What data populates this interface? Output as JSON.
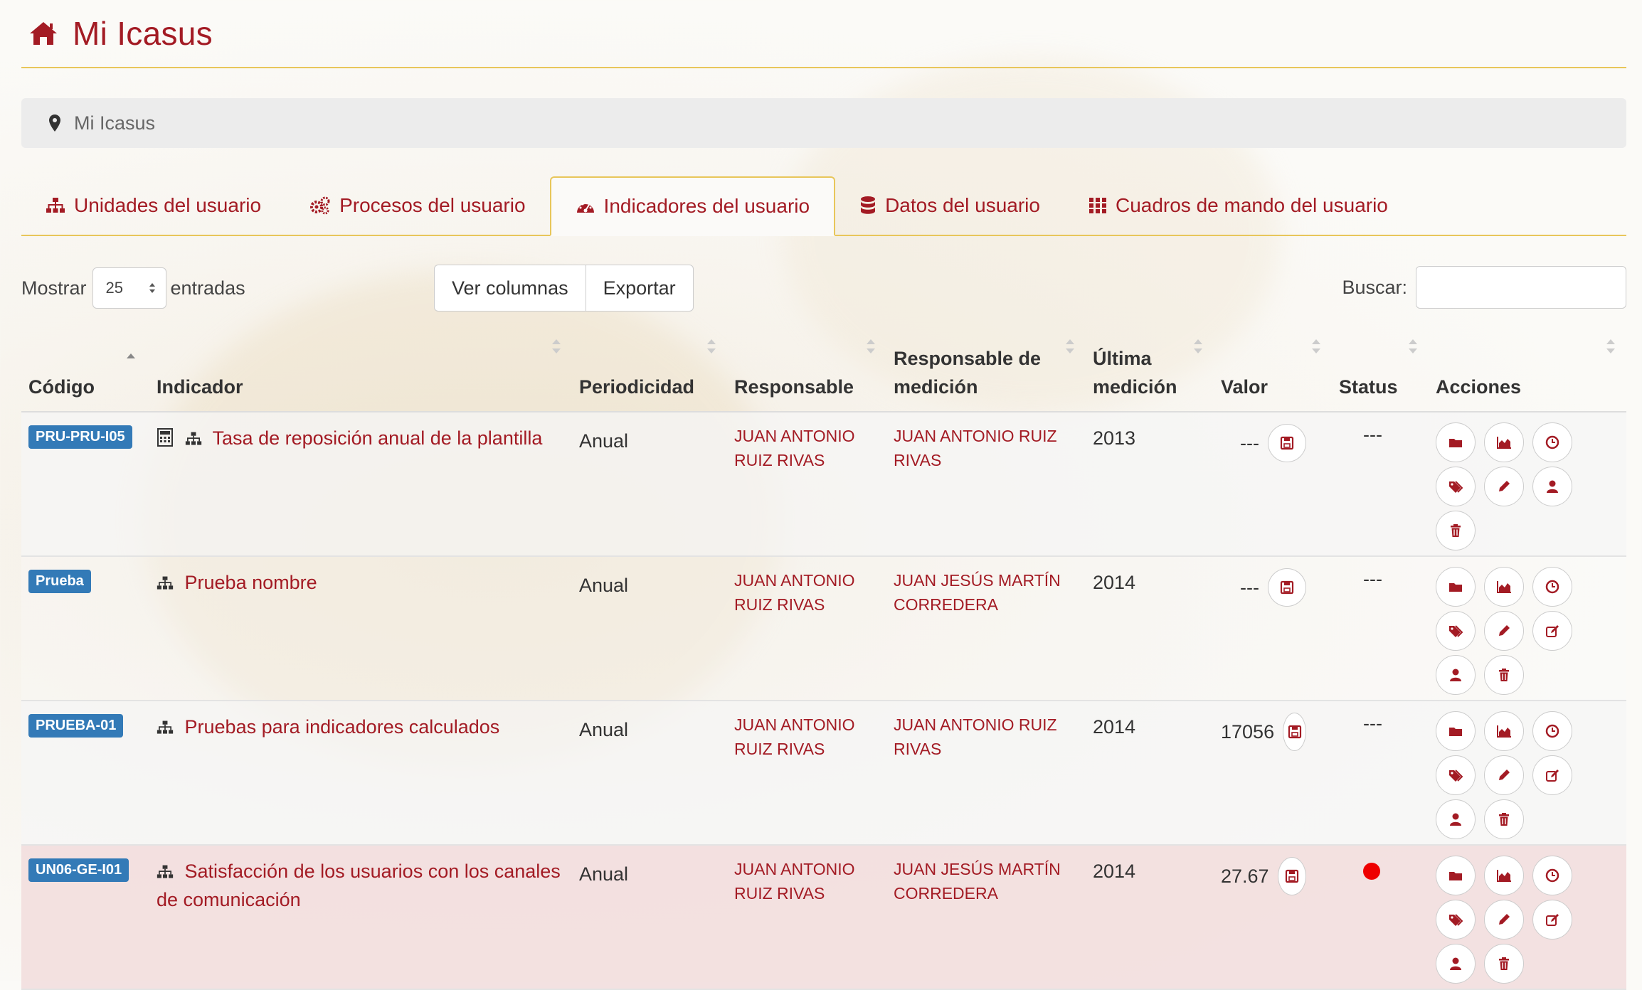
{
  "app": {
    "title": "Mi Icasus"
  },
  "breadcrumb": {
    "label": "Mi Icasus"
  },
  "tabs": [
    {
      "label": "Unidades del usuario",
      "icon": "sitemap-icon"
    },
    {
      "label": "Procesos del usuario",
      "icon": "gears-icon"
    },
    {
      "label": "Indicadores del usuario",
      "icon": "dashboard-icon",
      "active": true
    },
    {
      "label": "Datos del usuario",
      "icon": "database-icon"
    },
    {
      "label": "Cuadros de mando del usuario",
      "icon": "grid-icon"
    }
  ],
  "controls": {
    "show_label": "Mostrar",
    "page_size": "25",
    "entries_label": "entradas",
    "columns_button": "Ver columnas",
    "export_button": "Exportar",
    "search_label": "Buscar:"
  },
  "table": {
    "headers": {
      "codigo": "Código",
      "indicador": "Indicador",
      "periodicidad": "Periodicidad",
      "responsable": "Responsable",
      "resp_medicion_1": "Responsable de",
      "resp_medicion_2": "medición",
      "ultima_1": "Última",
      "ultima_2": "medición",
      "valor": "Valor",
      "status": "Status",
      "acciones": "Acciones"
    },
    "rows": [
      {
        "code": "PRU-PRU-I05",
        "indicator": "Tasa de reposición anual de la plantilla",
        "calc_icon": true,
        "period": "Anual",
        "resp_1": "JUAN ANTONIO",
        "resp_2": "RUIZ RIVAS",
        "respm_1": "JUAN ANTONIO RUIZ",
        "respm_2": "RIVAS",
        "year": "2013",
        "value": "---",
        "status": "---",
        "highlight": false,
        "actions": [
          "folder-icon",
          "area-chart-icon",
          "clock-icon",
          "tags-icon",
          "pencil-icon",
          "user-icon",
          "trash-icon"
        ]
      },
      {
        "code": "Prueba",
        "indicator": "Prueba nombre",
        "calc_icon": false,
        "period": "Anual",
        "resp_1": "JUAN ANTONIO",
        "resp_2": "RUIZ RIVAS",
        "respm_1": "JUAN JESÚS MARTÍN",
        "respm_2": "CORREDERA",
        "year": "2014",
        "value": "---",
        "status": "---",
        "highlight": false,
        "actions": [
          "folder-icon",
          "area-chart-icon",
          "clock-icon",
          "tags-icon",
          "pencil-icon",
          "edit-icon",
          "user-icon",
          "trash-icon"
        ]
      },
      {
        "code": "PRUEBA-01",
        "indicator": "Pruebas para indicadores calculados",
        "calc_icon": false,
        "period": "Anual",
        "resp_1": "JUAN ANTONIO",
        "resp_2": "RUIZ RIVAS",
        "respm_1": "JUAN ANTONIO RUIZ",
        "respm_2": "RIVAS",
        "year": "2014",
        "value": "17056",
        "status": "---",
        "highlight": false,
        "actions": [
          "folder-icon",
          "area-chart-icon",
          "clock-icon",
          "tags-icon",
          "pencil-icon",
          "edit-icon",
          "user-icon",
          "trash-icon"
        ]
      },
      {
        "code": "UN06-GE-I01",
        "indicator": "Satisfacción de los usuarios con los canales de comunicación",
        "calc_icon": false,
        "period": "Anual",
        "resp_1": "JUAN ANTONIO",
        "resp_2": "RUIZ RIVAS",
        "respm_1": "JUAN JESÚS MARTÍN",
        "respm_2": "CORREDERA",
        "year": "2014",
        "value": "27.67",
        "status": "red-dot",
        "highlight": true,
        "actions": [
          "folder-icon",
          "area-chart-icon",
          "clock-icon",
          "tags-icon",
          "pencil-icon",
          "edit-icon",
          "user-icon",
          "trash-icon"
        ]
      }
    ]
  },
  "colors": {
    "brand": "#a31b24",
    "accent_border": "#e8c65a",
    "badge": "#337ab7",
    "danger_row": "#f2dede",
    "status_red": "#e00000"
  }
}
